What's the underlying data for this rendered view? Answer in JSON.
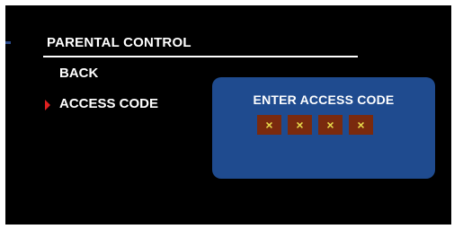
{
  "menu": {
    "title": "PARENTAL CONTROL",
    "items": [
      {
        "label": "BACK",
        "selected": false
      },
      {
        "label": "ACCESS CODE",
        "selected": true
      }
    ]
  },
  "dialog": {
    "title": "ENTER ACCESS CODE",
    "code_slots": [
      "×",
      "×",
      "×",
      "×"
    ]
  },
  "colors": {
    "background": "#000000",
    "dialog": "#1f4b8f",
    "code_box": "#7a2a0e",
    "code_glyph": "#e6d84a",
    "selection_arrow": "#e02020"
  }
}
